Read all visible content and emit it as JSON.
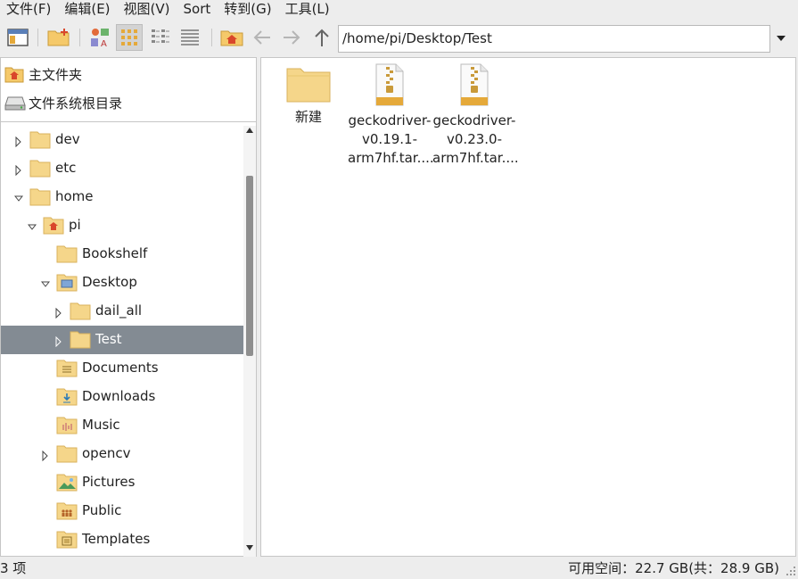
{
  "menubar": {
    "items": [
      "文件(F)",
      "编辑(E)",
      "视图(V)",
      "Sort",
      "转到(G)",
      "工具(L)"
    ]
  },
  "toolbar": {
    "buttons": [
      "new-window-icon",
      "new-folder-icon",
      "thumbnail-view-icon",
      "icon-view-icon",
      "compact-view-icon",
      "detailed-list-view-icon",
      "home-icon",
      "back-arrow-icon",
      "forward-arrow-icon",
      "up-arrow-icon"
    ],
    "active_view": "icon-view",
    "path": "/home/pi/Desktop/Test"
  },
  "places": {
    "items": [
      {
        "label": "主文件夹",
        "icon": "home-folder-icon"
      },
      {
        "label": "文件系统根目录",
        "icon": "drive-icon"
      }
    ]
  },
  "tree": {
    "items": [
      {
        "label": "dev",
        "icon": "folder-icon",
        "expander": "collapsed"
      },
      {
        "label": "etc",
        "icon": "folder-icon",
        "expander": "collapsed"
      },
      {
        "label": "home",
        "icon": "folder-icon",
        "expander": "expanded"
      },
      {
        "label": "pi",
        "icon": "home-folder-icon",
        "expander": "expanded"
      },
      {
        "label": "Bookshelf",
        "icon": "folder-icon",
        "expander": "none"
      },
      {
        "label": "Desktop",
        "icon": "desktop-folder-icon",
        "expander": "expanded"
      },
      {
        "label": "dail_all",
        "icon": "folder-icon",
        "expander": "collapsed"
      },
      {
        "label": "Test",
        "icon": "folder-icon",
        "expander": "collapsed",
        "selected": true
      },
      {
        "label": "Documents",
        "icon": "documents-folder-icon",
        "expander": "none"
      },
      {
        "label": "Downloads",
        "icon": "downloads-folder-icon",
        "expander": "none"
      },
      {
        "label": "Music",
        "icon": "music-folder-icon",
        "expander": "none"
      },
      {
        "label": "opencv",
        "icon": "folder-icon",
        "expander": "collapsed"
      },
      {
        "label": "Pictures",
        "icon": "pictures-folder-icon",
        "expander": "none"
      },
      {
        "label": "Public",
        "icon": "public-folder-icon",
        "expander": "none"
      },
      {
        "label": "Templates",
        "icon": "templates-folder-icon",
        "expander": "none"
      }
    ]
  },
  "files": {
    "items": [
      {
        "name_lines": [
          "新建"
        ],
        "icon": "folder-icon"
      },
      {
        "name_lines": [
          "geckodriver-",
          "v0.19.1-",
          "arm7hf.tar...."
        ],
        "icon": "archive-icon"
      },
      {
        "name_lines": [
          "geckodriver-",
          "v0.23.0-",
          "arm7hf.tar...."
        ],
        "icon": "archive-icon"
      }
    ]
  },
  "status": {
    "count": "3 项",
    "free_space": "可用空间：22.7 GB(共：28.9 GB)"
  },
  "colors": {
    "folder": "#f5d68a",
    "selection": "#838b93",
    "accent_home": "#d9472b"
  }
}
